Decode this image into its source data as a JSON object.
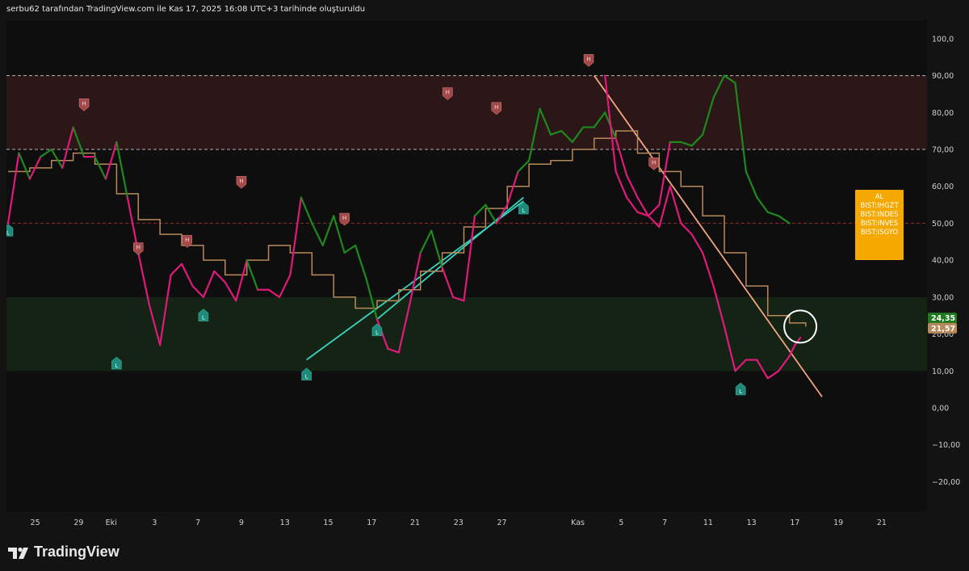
{
  "header": {
    "caption": "serbu62 tarafından TradingView.com ile Kas 17, 2025 16:08 UTC+3 tarihinde oluşturuldu"
  },
  "brand": {
    "name": "TradingView"
  },
  "signal_box": {
    "title": "AL",
    "items": [
      "BIST:IHGZT",
      "BIST:INDES",
      "BIST:INVES",
      "BIST:ISGYO"
    ],
    "color": "#f5a800"
  },
  "price_badges": [
    {
      "label": "24,35",
      "color": "#1e7a1e"
    },
    {
      "label": "21,57",
      "color": "#b8895a"
    }
  ],
  "colors": {
    "green_line": "#1e8a1e",
    "pink_line": "#e0197a",
    "tan_line": "#b8895a",
    "cyan_line": "#36d6c0",
    "salmon_line": "#f4a582",
    "overbought_zone": "#2b1717",
    "oversold_zone": "#142314"
  },
  "chart_data": {
    "type": "line",
    "ylim": [
      -28,
      105
    ],
    "yticks": [
      100,
      90,
      80,
      70,
      60,
      50,
      40,
      30,
      20,
      10,
      0,
      -10,
      -20
    ],
    "ytick_labels": [
      "100,0",
      "90,00",
      "80,00",
      "70,00",
      "60,00",
      "50,00",
      "40,00",
      "30,00",
      "20,00",
      "10,00",
      "0,00",
      "−10,00",
      "−20,00"
    ],
    "xticks": [
      {
        "label": "25",
        "i": 5
      },
      {
        "label": "29",
        "i": 13
      },
      {
        "label": "Eki",
        "i": 19
      },
      {
        "label": "3",
        "i": 27
      },
      {
        "label": "7",
        "i": 35
      },
      {
        "label": "9",
        "i": 43
      },
      {
        "label": "13",
        "i": 51
      },
      {
        "label": "15",
        "i": 59
      },
      {
        "label": "17",
        "i": 67
      },
      {
        "label": "21",
        "i": 75
      },
      {
        "label": "23",
        "i": 83
      },
      {
        "label": "27",
        "i": 91
      },
      {
        "label": "Kas",
        "i": 105
      },
      {
        "label": "5",
        "i": 113
      },
      {
        "label": "7",
        "i": 121
      },
      {
        "label": "11",
        "i": 129
      },
      {
        "label": "13",
        "i": 137
      },
      {
        "label": "17",
        "i": 145
      },
      {
        "label": "19",
        "i": 153
      },
      {
        "label": "21",
        "i": 161
      }
    ],
    "levels": [
      90,
      70,
      50
    ],
    "zones": [
      {
        "name": "overbought",
        "from": 70,
        "to": 90
      },
      {
        "name": "oversold",
        "from": 10,
        "to": 30
      }
    ],
    "oscillator_x": [
      0,
      2,
      4,
      6,
      8,
      10,
      12,
      14,
      16,
      18,
      20,
      22,
      24,
      26,
      28,
      30,
      32,
      34,
      36,
      38,
      40,
      42,
      44,
      46,
      48,
      50,
      52,
      54,
      56,
      58,
      60,
      62,
      64,
      66,
      68,
      70,
      72,
      74,
      76,
      78,
      80,
      82,
      84,
      86,
      88,
      90,
      92,
      94,
      96,
      98,
      100,
      102,
      104,
      106,
      108,
      110,
      112,
      114,
      116,
      118,
      120,
      122,
      124,
      126,
      128,
      130,
      132,
      134,
      136,
      138,
      140,
      142,
      144
    ],
    "oscillator_y": [
      50,
      69,
      62,
      68,
      70,
      65,
      76,
      68,
      68,
      62,
      72,
      57,
      42,
      28,
      17,
      36,
      39,
      33,
      30,
      37,
      34,
      29,
      40,
      32,
      32,
      30,
      36,
      57,
      50,
      44,
      52,
      42,
      44,
      35,
      24,
      16,
      15,
      28,
      42,
      48,
      38,
      30,
      29,
      52,
      55,
      50,
      55,
      64,
      67,
      81,
      74,
      75,
      72,
      76,
      76,
      80,
      73,
      63,
      57,
      52,
      55,
      72,
      72,
      71,
      74,
      84,
      90,
      88,
      64,
      57,
      53,
      52,
      50
    ],
    "oscillator_tail_x": [
      110,
      112,
      114,
      116,
      118,
      120,
      122,
      124,
      126,
      128,
      130,
      132,
      134,
      136,
      138,
      140,
      142,
      144,
      145,
      146
    ],
    "oscillator_tail_y": [
      90,
      64,
      57,
      53,
      52,
      49,
      60,
      50,
      47,
      42,
      33,
      22,
      10,
      13,
      13,
      8,
      10,
      14,
      17,
      19
    ],
    "signal_line_x": [
      0,
      4,
      8,
      12,
      16,
      20,
      24,
      28,
      32,
      36,
      40,
      44,
      48,
      52,
      56,
      60,
      64,
      68,
      72,
      76,
      80,
      84,
      88,
      92,
      96,
      100,
      104,
      108,
      112,
      116,
      120,
      124,
      128,
      132,
      136,
      140,
      144,
      147
    ],
    "signal_line_y": [
      64,
      65,
      67,
      69,
      66,
      58,
      51,
      47,
      44,
      40,
      36,
      40,
      44,
      42,
      36,
      30,
      27,
      29,
      32,
      37,
      42,
      49,
      54,
      60,
      66,
      67,
      70,
      73,
      75,
      69,
      64,
      60,
      52,
      42,
      33,
      25,
      23,
      22
    ],
    "markers": [
      {
        "type": "H",
        "i": 14,
        "y": 80
      },
      {
        "type": "H",
        "i": 24,
        "y": 41
      },
      {
        "type": "H",
        "i": 33,
        "y": 43
      },
      {
        "type": "H",
        "i": 43,
        "y": 59
      },
      {
        "type": "H",
        "i": 62,
        "y": 49
      },
      {
        "type": "H",
        "i": 81,
        "y": 83
      },
      {
        "type": "H",
        "i": 90,
        "y": 79
      },
      {
        "type": "H",
        "i": 107,
        "y": 92
      },
      {
        "type": "H",
        "i": 119,
        "y": 64
      },
      {
        "type": "L",
        "i": 0,
        "y": 50
      },
      {
        "type": "L",
        "i": 20,
        "y": 14
      },
      {
        "type": "L",
        "i": 36,
        "y": 27
      },
      {
        "type": "L",
        "i": 55,
        "y": 11
      },
      {
        "type": "L",
        "i": 68,
        "y": 23
      },
      {
        "type": "L",
        "i": 95,
        "y": 56
      },
      {
        "type": "L",
        "i": 135,
        "y": 7
      }
    ]
  }
}
